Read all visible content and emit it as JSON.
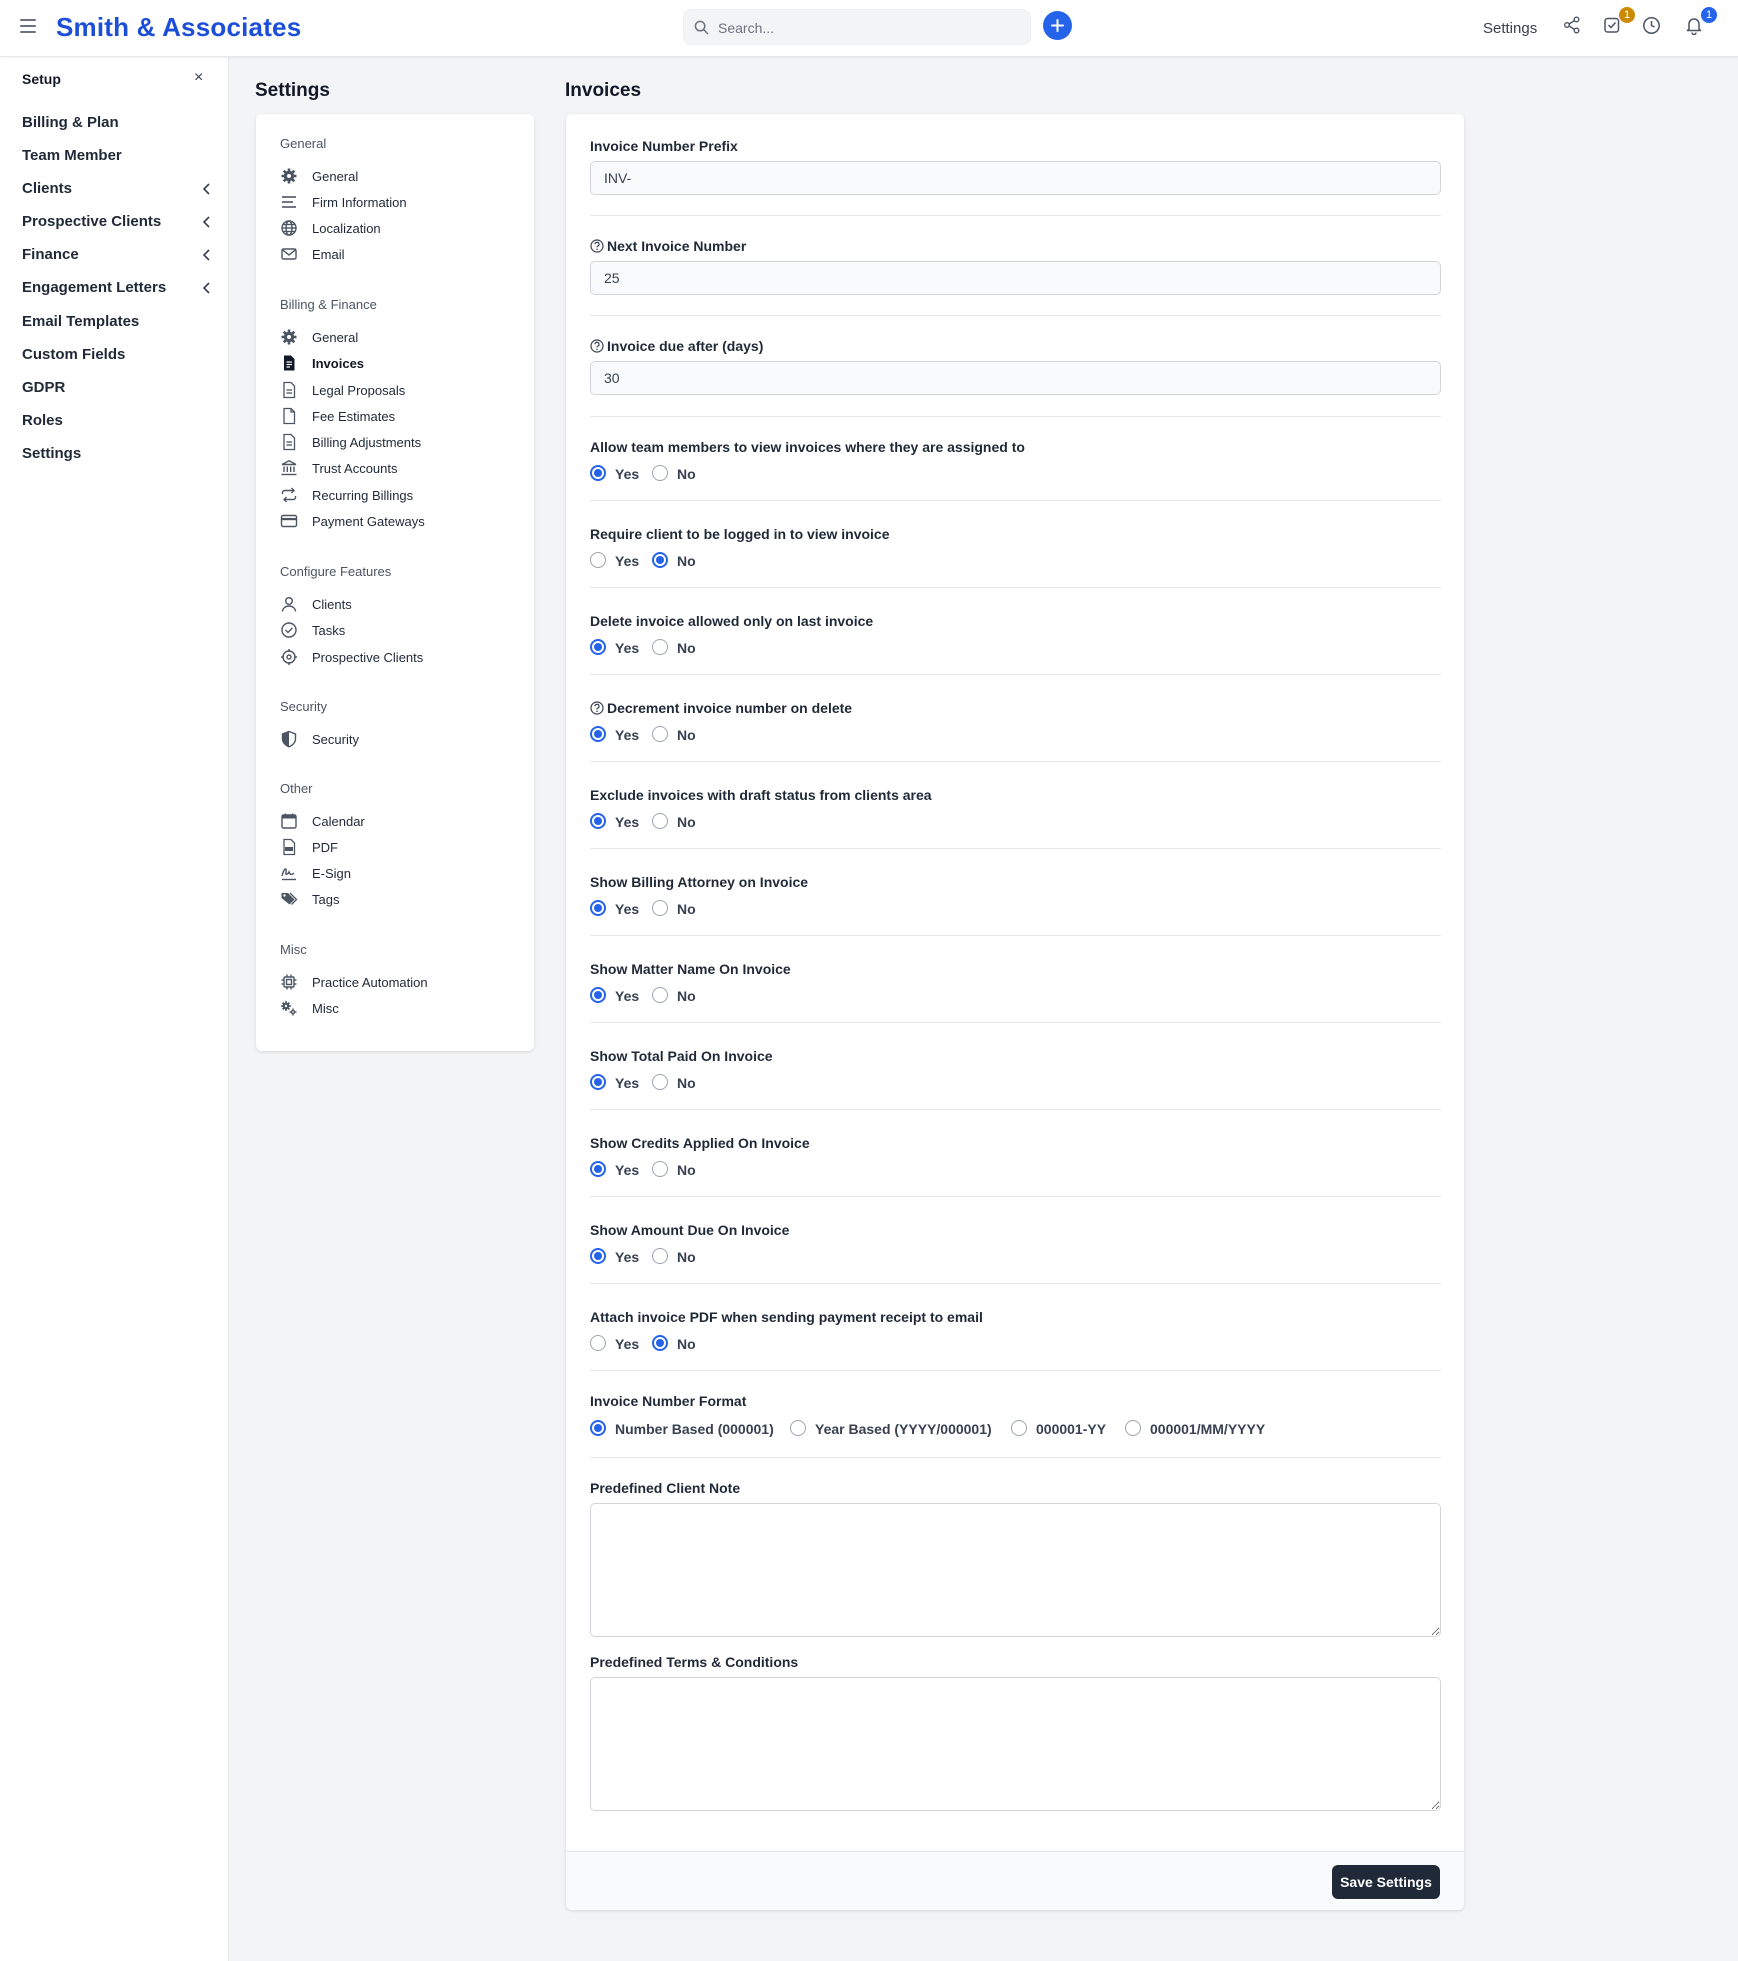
{
  "brand": "Smith & Associates",
  "search": {
    "placeholder": "Search..."
  },
  "topbar": {
    "settings_label": "Settings",
    "tasks_badge": "1",
    "notifications_badge": "1",
    "tasks_badge_color": "#ca8a04",
    "notifications_badge_color": "#2563eb"
  },
  "sidebar": {
    "title": "Setup",
    "close": "×",
    "items": [
      {
        "label": "Billing & Plan"
      },
      {
        "label": "Team Member"
      },
      {
        "label": "Clients"
      },
      {
        "label": "Prospective Clients"
      },
      {
        "label": "Finance"
      },
      {
        "label": "Engagement Letters"
      },
      {
        "label": "Email Templates"
      },
      {
        "label": "Custom Fields"
      },
      {
        "label": "GDPR"
      },
      {
        "label": "Roles"
      },
      {
        "label": "Settings"
      }
    ]
  },
  "settings_nav": {
    "title": "Settings",
    "groups": [
      {
        "label": "General",
        "items": [
          {
            "label": "General",
            "icon": "gear-icon"
          },
          {
            "label": "Firm Information",
            "icon": "lines-icon"
          },
          {
            "label": "Localization",
            "icon": "globe-icon"
          },
          {
            "label": "Email",
            "icon": "envelope-icon"
          }
        ]
      },
      {
        "label": "Billing & Finance",
        "items": [
          {
            "label": "General",
            "icon": "gear-icon"
          },
          {
            "label": "Invoices",
            "icon": "invoice-icon"
          },
          {
            "label": "Legal Proposals",
            "icon": "document-icon"
          },
          {
            "label": "Fee Estimates",
            "icon": "file-icon"
          },
          {
            "label": "Billing Adjustments",
            "icon": "document-icon"
          },
          {
            "label": "Trust Accounts",
            "icon": "bank-icon"
          },
          {
            "label": "Recurring Billings",
            "icon": "repeat-icon"
          },
          {
            "label": "Payment Gateways",
            "icon": "credit-card-icon"
          }
        ]
      },
      {
        "label": "Configure Features",
        "items": [
          {
            "label": "Clients",
            "icon": "user-icon"
          },
          {
            "label": "Tasks",
            "icon": "check-circle-icon"
          },
          {
            "label": "Prospective Clients",
            "icon": "crosshair-icon"
          }
        ]
      },
      {
        "label": "Security",
        "items": [
          {
            "label": "Security",
            "icon": "shield-icon"
          }
        ]
      },
      {
        "label": "Other",
        "items": [
          {
            "label": "Calendar",
            "icon": "calendar-icon"
          },
          {
            "label": "PDF",
            "icon": "pdf-icon"
          },
          {
            "label": "E-Sign",
            "icon": "signature-icon"
          },
          {
            "label": "Tags",
            "icon": "tags-icon"
          }
        ]
      },
      {
        "label": "Misc",
        "items": [
          {
            "label": "Practice Automation",
            "icon": "chip-icon"
          },
          {
            "label": "Misc",
            "icon": "gears-icon"
          }
        ]
      }
    ]
  },
  "form": {
    "title": "Invoices",
    "invoice_number_prefix": {
      "label": "Invoice Number Prefix",
      "value": "INV-"
    },
    "next_invoice_number": {
      "label": "Next Invoice Number",
      "value": "25"
    },
    "invoice_due_after": {
      "label": "Invoice due after (days)",
      "value": "30"
    },
    "yes_label": "Yes",
    "no_label": "No",
    "yes_no": [
      {
        "label": "Allow team members to view invoices where they are assigned to",
        "selected": "yes",
        "help": false
      },
      {
        "label": "Require client to be logged in to view invoice",
        "selected": "no",
        "help": false
      },
      {
        "label": "Delete invoice allowed only on last invoice",
        "selected": "yes",
        "help": false
      },
      {
        "label": "Decrement invoice number on delete",
        "selected": "yes",
        "help": true
      },
      {
        "label": "Exclude invoices with draft status from clients area",
        "selected": "yes",
        "help": false
      },
      {
        "label": "Show Billing Attorney on Invoice",
        "selected": "yes",
        "help": false
      },
      {
        "label": "Show Matter Name On Invoice",
        "selected": "yes",
        "help": false
      },
      {
        "label": "Show Total Paid On Invoice",
        "selected": "yes",
        "help": false
      },
      {
        "label": "Show Credits Applied On Invoice",
        "selected": "yes",
        "help": false
      },
      {
        "label": "Show Amount Due On Invoice",
        "selected": "yes",
        "help": false
      },
      {
        "label": "Attach invoice PDF when sending payment receipt to email",
        "selected": "no",
        "help": false
      }
    ],
    "number_format": {
      "label": "Invoice Number Format",
      "options": [
        "Number Based (000001)",
        "Year Based (YYYY/000001)",
        "000001-YY",
        "000001/MM/YYYY"
      ],
      "selected": "Number Based (000001)"
    },
    "client_note": {
      "label": "Predefined Client Note",
      "value": ""
    },
    "terms": {
      "label": "Predefined Terms & Conditions",
      "value": ""
    },
    "save_label": "Save Settings"
  }
}
